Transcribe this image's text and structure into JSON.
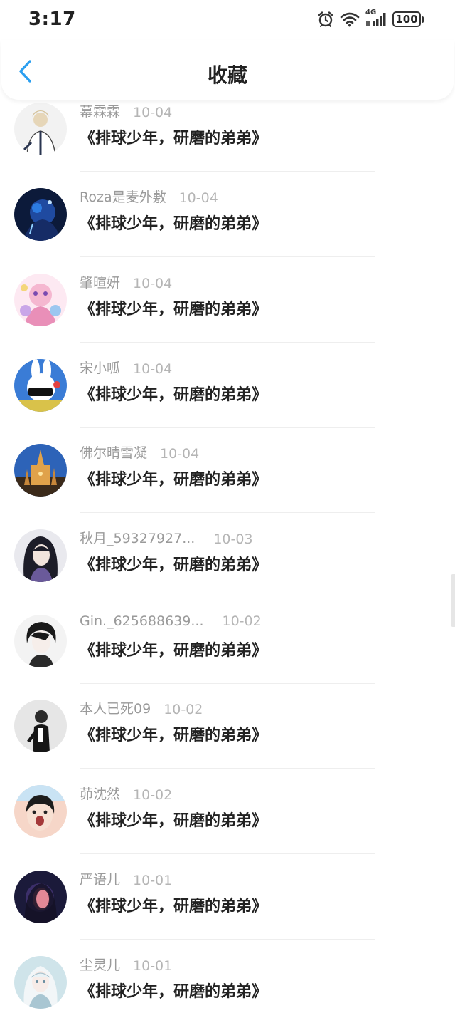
{
  "status_bar": {
    "time": "3:17",
    "network": "4G",
    "battery": "100",
    "icons": [
      "alarm-icon",
      "wifi-icon",
      "signal-icon",
      "battery-icon"
    ]
  },
  "header": {
    "back_icon": "chevron-left-icon",
    "title": "收藏",
    "accent_color": "#2b9ff0"
  },
  "favorites": [
    {
      "username": "幕霖霖",
      "date": "10-04",
      "title": "《排球少年，研磨的弟弟》"
    },
    {
      "username": "Roza是麦外敷",
      "date": "10-04",
      "title": "《排球少年，研磨的弟弟》"
    },
    {
      "username": "肇暄妍",
      "date": "10-04",
      "title": "《排球少年，研磨的弟弟》"
    },
    {
      "username": "宋小呱",
      "date": "10-04",
      "title": "《排球少年，研磨的弟弟》"
    },
    {
      "username": "佛尔晴雪凝",
      "date": "10-04",
      "title": "《排球少年，研磨的弟弟》"
    },
    {
      "username": "秋月_59327927...",
      "date": "10-03",
      "title": "《排球少年，研磨的弟弟》"
    },
    {
      "username": "Gin._625688639...",
      "date": "10-02",
      "title": "《排球少年，研磨的弟弟》"
    },
    {
      "username": "本人已死09",
      "date": "10-02",
      "title": "《排球少年，研磨的弟弟》"
    },
    {
      "username": "茆沈然",
      "date": "10-02",
      "title": "《排球少年，研磨的弟弟》"
    },
    {
      "username": "严语儿",
      "date": "10-01",
      "title": "《排球少年，研磨的弟弟》"
    },
    {
      "username": "尘灵儿",
      "date": "10-01",
      "title": "《排球少年，研磨的弟弟》"
    }
  ]
}
